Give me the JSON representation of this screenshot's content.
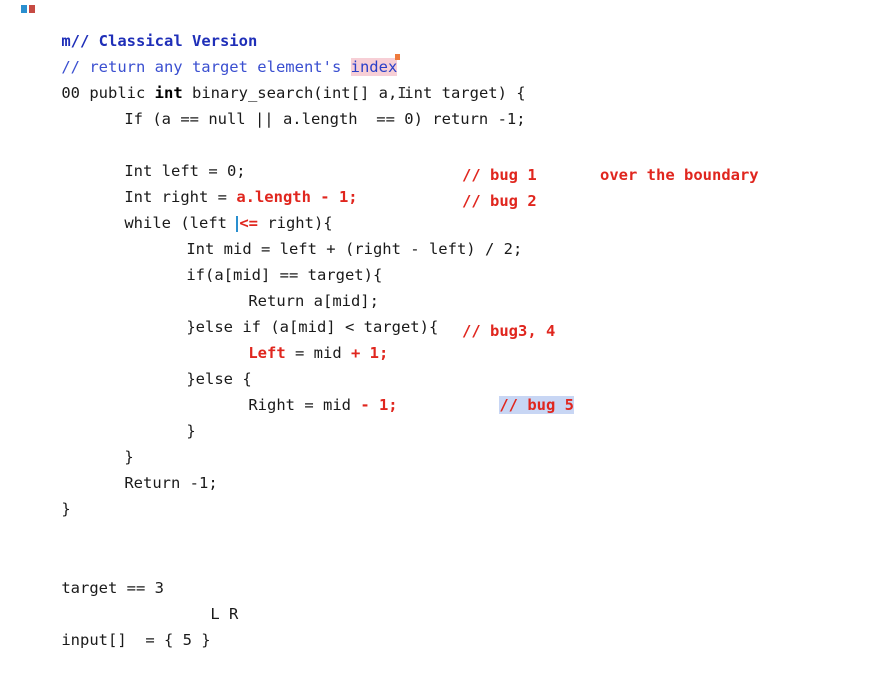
{
  "code": {
    "header_marker": "m",
    "header_comment": "// Classical Version",
    "return_comment_prefix": "// return any target element's ",
    "return_comment_highlight": "index",
    "sig_prefix": "00 public ",
    "sig_kw": "int",
    "sig_mid": " binary_search(int[] a,",
    "sig_end": "int target) {",
    "line_if": "If (a == null || a.length  == 0) return -1;",
    "line_left": "Int left = 0;",
    "line_right_prefix": "Int right = ",
    "line_right_bug": "a.length - 1;",
    "bug1_comment": "// bug 1",
    "bug1_note": "over the boundary",
    "line_while_prefix": "while (left ",
    "line_while_op": "<=",
    "line_while_suffix": " right){",
    "bug2_comment": "// bug 2",
    "line_mid": "Int mid = left + (right - left) / 2;",
    "line_if_eq": "if(a[mid] == target){",
    "line_return_mid": "Return a[mid];",
    "line_elseif": "}else if (a[mid] < target){",
    "line_left_assign_kw": "Left",
    "line_left_assign_mid": " = mid ",
    "line_left_assign_bug": "+ 1;",
    "bug34_comment": "// bug3, 4",
    "line_else": "}else {",
    "line_right_assign_prefix": "Right = mid ",
    "line_right_assign_bug": "- 1;",
    "bug5_comment": "// bug 5",
    "close_inner": "}",
    "close_while": "}",
    "line_return_neg": "Return -1;",
    "close_func": "}"
  },
  "notes": {
    "target_line": "target == 3",
    "pointers_line": "L R",
    "input_line": "input[]  = { 5 }"
  },
  "colors": {
    "comment": "#3a4fd0",
    "bug_red": "#e0261e",
    "pink_highlight": "#f7cfd6",
    "blue_highlight": "#c8d6f4"
  }
}
